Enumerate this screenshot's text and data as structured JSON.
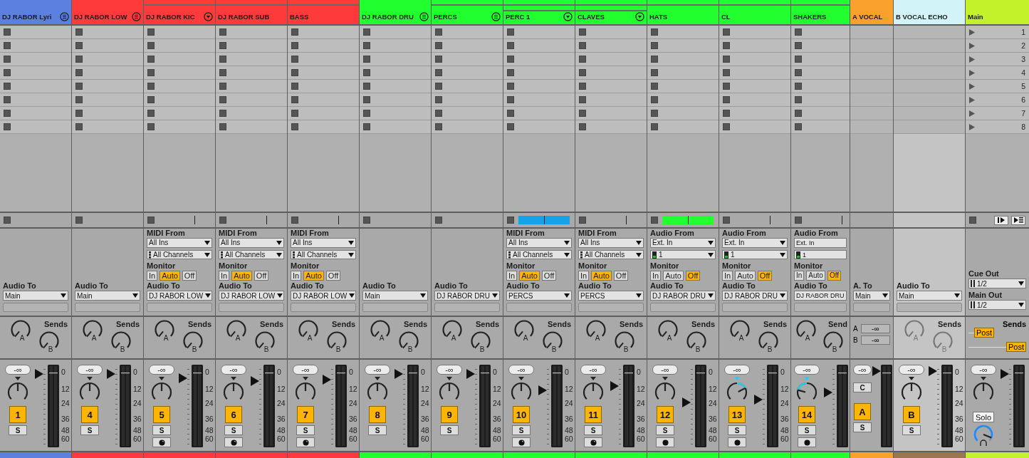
{
  "tracks": [
    {
      "name": "DJ RABOR Lyri",
      "kind": "group",
      "color": "#5b80e0",
      "header_icon": {
        "kind": "lines"
      },
      "selected": false,
      "io": {
        "audio_to_label": "Audio To",
        "audio_to": "Main"
      },
      "sends_label": "Sends",
      "send_knobs": [
        {
          "label": "A"
        },
        {
          "label": "B"
        }
      ],
      "volume": "-∞",
      "pan_knob": {
        "kind": "center"
      },
      "number": "1",
      "solo": "S",
      "fader": {
        "level": 0.89
      },
      "meter_scale": [
        "0",
        "12",
        "24",
        "36",
        "48",
        "60"
      ]
    },
    {
      "name": "DJ RABOR LOW",
      "kind": "group",
      "color": "#ff3a3a",
      "header_icon": {
        "kind": "lines"
      },
      "selected": false,
      "io": {
        "audio_to_label": "Audio To",
        "audio_to": "Main"
      },
      "sends_label": "Sends",
      "send_knobs": [
        {
          "label": "A"
        },
        {
          "label": "B"
        }
      ],
      "volume": "-∞",
      "pan_knob": {
        "kind": "center"
      },
      "number": "4",
      "solo": "S",
      "fader": {
        "level": 0.89
      },
      "meter_scale": [
        "0",
        "12",
        "24",
        "36",
        "48",
        "60"
      ],
      "children": [
        {
          "name": "DJ RABOR KIC",
          "kind": "midi",
          "color": "#ff3a3a",
          "header_icon": {
            "kind": "arrow"
          },
          "selected": false,
          "io": {
            "from_label": "MIDI From",
            "from": "All Ins",
            "channel": "All Channels",
            "monitor_label": "Monitor",
            "monitor": [
              {
                "label": "In",
                "selected": false
              },
              {
                "label": "Auto",
                "selected": true
              },
              {
                "label": "Off",
                "selected": false
              }
            ],
            "audio_to_label": "Audio To",
            "audio_to": "DJ RABOR LOW"
          },
          "sends_label": "Sends",
          "send_knobs": [
            {
              "label": "A"
            },
            {
              "label": "B"
            }
          ],
          "volume": "-∞",
          "pan_knob": {
            "kind": "center"
          },
          "number": "5",
          "solo": "S",
          "fader": {
            "level": 0.84
          },
          "meter_scale": [
            "0",
            "12",
            "24",
            "36",
            "48",
            "60"
          ]
        },
        {
          "name": "DJ RABOR SUB",
          "kind": "midi",
          "color": "#ff3a3a",
          "selected": false,
          "io": {
            "from_label": "MIDI From",
            "from": "All Ins",
            "channel": "All Channels",
            "monitor_label": "Monitor",
            "monitor": [
              {
                "label": "In",
                "selected": false
              },
              {
                "label": "Auto",
                "selected": true
              },
              {
                "label": "Off",
                "selected": false
              }
            ],
            "audio_to_label": "Audio To",
            "audio_to": "DJ RABOR LOW"
          },
          "sends_label": "Sends",
          "send_knobs": [
            {
              "label": "A"
            },
            {
              "label": "B"
            }
          ],
          "volume": "-∞",
          "pan_knob": {
            "kind": "center"
          },
          "number": "6",
          "solo": "S",
          "fader": {
            "level": 0.8
          },
          "meter_scale": [
            "0",
            "12",
            "24",
            "36",
            "48",
            "60"
          ]
        },
        {
          "name": "BASS",
          "kind": "midi",
          "color": "#ff3a3a",
          "selected": false,
          "io": {
            "from_label": "MIDI From",
            "from": "All Ins",
            "channel": "All Channels",
            "monitor_label": "Monitor",
            "monitor": [
              {
                "label": "In",
                "selected": false
              },
              {
                "label": "Auto",
                "selected": true
              },
              {
                "label": "Off",
                "selected": false
              }
            ],
            "audio_to_label": "Audio To",
            "audio_to": "DJ RABOR LOW"
          },
          "sends_label": "Sends",
          "send_knobs": [
            {
              "label": "A"
            },
            {
              "label": "B"
            }
          ],
          "volume": "-∞",
          "pan_knob": {
            "kind": "center"
          },
          "number": "7",
          "solo": "S",
          "fader": {
            "level": 0.82
          },
          "meter_scale": [
            "0",
            "12",
            "24",
            "36",
            "48",
            "60"
          ]
        }
      ]
    },
    {
      "name": "DJ RABOR DRU",
      "kind": "group",
      "color": "#22ff2f",
      "header_icon": {
        "kind": "lines"
      },
      "selected": false,
      "io": {
        "audio_to_label": "Audio To",
        "audio_to": "Main"
      },
      "sends_label": "Sends",
      "send_knobs": [
        {
          "label": "A"
        },
        {
          "label": "B"
        }
      ],
      "volume": "-∞",
      "pan_knob": {
        "kind": "center"
      },
      "number": "8",
      "solo": "S",
      "fader": {
        "level": 0.89
      },
      "meter_scale": [
        "0",
        "12",
        "24",
        "36",
        "48",
        "60"
      ],
      "children": [
        {
          "name": "PERCS",
          "kind": "group",
          "color": "#22ff2f",
          "header_icon": {
            "kind": "lines"
          },
          "selected": false,
          "io": {
            "audio_to_label": "Audio To",
            "audio_to": "DJ RABOR DRU"
          },
          "sends_label": "Sends",
          "send_knobs": [
            {
              "label": "A"
            },
            {
              "label": "B"
            }
          ],
          "volume": "-∞",
          "pan_knob": {
            "kind": "center"
          },
          "number": "9",
          "solo": "S",
          "fader": {
            "level": 0.89
          },
          "meter_scale": [
            "0",
            "12",
            "24",
            "36",
            "48",
            "60"
          ],
          "children": [
            {
              "name": "PERC 1",
              "kind": "midi",
              "color": "#22ff2f",
              "header_icon": {
                "kind": "arrow"
              },
              "selected": false,
              "clip_bar": {
                "color": "#14a3e6"
              },
              "io": {
                "from_label": "MIDI From",
                "from": "All Ins",
                "channel": "All Channels",
                "monitor_label": "Monitor",
                "monitor": [
                  {
                    "label": "In",
                    "selected": false
                  },
                  {
                    "label": "Auto",
                    "selected": true
                  },
                  {
                    "label": "Off",
                    "selected": false
                  }
                ],
                "audio_to_label": "Audio To",
                "audio_to": "PERCS"
              },
              "sends_label": "Sends",
              "send_knobs": [
                {
                  "label": "A"
                },
                {
                  "label": "B"
                }
              ],
              "volume": "-∞",
              "pan_knob": {
                "kind": "center"
              },
              "number": "10",
              "solo": "S",
              "fader": {
                "level": 0.69
              },
              "meter_scale": [
                "0",
                "12",
                "24",
                "36",
                "48",
                "60"
              ]
            },
            {
              "name": "CLAVES",
              "kind": "midi",
              "color": "#22ff2f",
              "header_icon": {
                "kind": "arrow"
              },
              "selected": false,
              "io": {
                "from_label": "MIDI From",
                "from": "All Ins",
                "channel": "All Channels",
                "monitor_label": "Monitor",
                "monitor": [
                  {
                    "label": "In",
                    "selected": false
                  },
                  {
                    "label": "Auto",
                    "selected": true
                  },
                  {
                    "label": "Off",
                    "selected": false
                  }
                ],
                "audio_to_label": "Audio To",
                "audio_to": "PERCS"
              },
              "sends_label": "Sends",
              "send_knobs": [
                {
                  "label": "A"
                },
                {
                  "label": "B"
                }
              ],
              "volume": "-∞",
              "pan_knob": {
                "kind": "center"
              },
              "number": "11",
              "solo": "S",
              "fader": {
                "level": 0.74
              },
              "meter_scale": [
                "0",
                "12",
                "24",
                "36",
                "48",
                "60"
              ]
            }
          ]
        },
        {
          "name": "HATS",
          "kind": "audio",
          "color": "#22ff2f",
          "selected": false,
          "clip_bar": {
            "color": "#22ff2f"
          },
          "io": {
            "from_label": "Audio From",
            "from": "Ext. In",
            "channel": "1",
            "monitor_label": "Monitor",
            "monitor": [
              {
                "label": "In",
                "selected": false
              },
              {
                "label": "Auto",
                "selected": false
              },
              {
                "label": "Off",
                "selected": true
              }
            ],
            "audio_to_label": "Audio To",
            "audio_to": "DJ RABOR DRU"
          },
          "sends_label": "Sends",
          "send_knobs": [
            {
              "label": "A"
            },
            {
              "label": "B"
            }
          ],
          "volume": "-∞",
          "pan_knob": {
            "kind": "center"
          },
          "number": "12",
          "solo": "S",
          "fader": {
            "level": 0.54
          },
          "meter_scale": [
            "0",
            "12",
            "24",
            "36",
            "48",
            "60"
          ]
        },
        {
          "name": "CL",
          "kind": "audio",
          "color": "#22ff2f",
          "selected": false,
          "io": {
            "from_label": "Audio From",
            "from": "Ext. In",
            "channel": "1",
            "monitor_label": "Monitor",
            "monitor": [
              {
                "label": "In",
                "selected": false
              },
              {
                "label": "Auto",
                "selected": false
              },
              {
                "label": "Off",
                "selected": true
              }
            ],
            "audio_to_label": "Audio To",
            "audio_to": "DJ RABOR DRU"
          },
          "sends_label": "Sends",
          "send_knobs": [
            {
              "label": "A"
            },
            {
              "label": "B"
            }
          ],
          "volume": "-∞",
          "pan_knob": {
            "kind": "right"
          },
          "number": "13",
          "solo": "S",
          "fader": {
            "level": 0.58
          },
          "meter_scale": [
            "0",
            "12",
            "24",
            "36",
            "48",
            "60"
          ]
        },
        {
          "name": "SHAKERS",
          "kind": "audio",
          "color": "#22ff2f",
          "selected": false,
          "io": {
            "from_label": "Audio From",
            "from": "Ext. In",
            "channel": "1",
            "monitor_label": "Monitor",
            "monitor": [
              {
                "label": "In",
                "selected": false
              },
              {
                "label": "Auto",
                "selected": false
              },
              {
                "label": "Off",
                "selected": true
              }
            ],
            "audio_to_label": "Audio To",
            "audio_to": "DJ RABOR DRU"
          },
          "sends_label": "Send",
          "send_knobs": [
            {
              "label": "A"
            },
            {
              "label": "B"
            }
          ],
          "volume": "-∞",
          "pan_knob": {
            "kind": "left"
          },
          "number": "14",
          "solo": "S",
          "fader": {
            "level": 0.66
          }
        }
      ]
    }
  ],
  "returns": [
    {
      "name": "A VOCAL",
      "kind": "compact",
      "color": "#f9a12c",
      "strip": {
        "color": "#f9a12c"
      },
      "selected": false,
      "io": {
        "audio_to_label": "A. To",
        "audio_to": "Main"
      },
      "send_values": [
        {
          "label": "A",
          "value": "-∞"
        },
        {
          "label": "B",
          "value": "-∞"
        }
      ],
      "volume": "-∞",
      "crossfade": "C",
      "number": "A",
      "solo": "S",
      "fader": {
        "level": 0.92
      }
    },
    {
      "name": "B VOCAL ECHO",
      "kind": "full",
      "color": "#d2f4f8",
      "strip": {
        "color": "#9c7651"
      },
      "selected": true,
      "io": {
        "audio_to_label": "Audio To",
        "audio_to": "Main"
      },
      "sends_label": "Sends",
      "send_knobs": [
        {
          "label": "A"
        },
        {
          "label": "B"
        }
      ],
      "sends_disabled": true,
      "volume": "-∞",
      "pan_knob": {
        "kind": "center"
      },
      "number": "B",
      "solo": "S",
      "fader": {
        "level": 0.92
      },
      "meter_scale": [
        "0",
        "12",
        "24",
        "36",
        "48",
        "60"
      ]
    }
  ],
  "main": {
    "name": "Main",
    "color": "#c3f12a",
    "selected": false,
    "scenes": [
      {
        "number": "1"
      },
      {
        "number": "2"
      },
      {
        "number": "3"
      },
      {
        "number": "4"
      },
      {
        "number": "5"
      },
      {
        "number": "6"
      },
      {
        "number": "7"
      },
      {
        "number": "8"
      }
    ],
    "cue_out_label": "Cue Out",
    "cue_out": "1/2",
    "main_out_label": "Main Out",
    "main_out": "1/2",
    "sends_label": "Sends",
    "posts": [
      "Post",
      "Post"
    ],
    "volume": "-∞",
    "pan_knob": {
      "kind": "center"
    },
    "solo": "Solo",
    "fader": {
      "level": 0.89
    }
  }
}
